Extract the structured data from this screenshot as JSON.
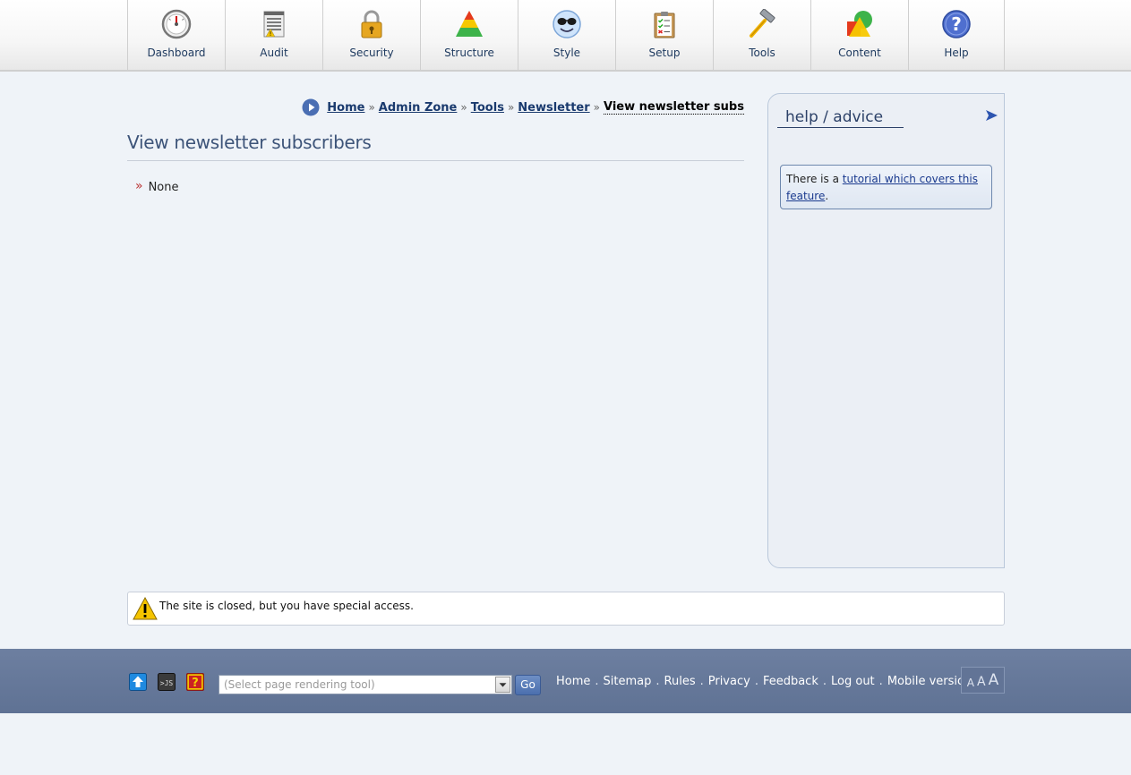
{
  "nav": {
    "items": [
      {
        "label": "Dashboard",
        "icon": "dashboard-gauge-icon"
      },
      {
        "label": "Audit",
        "icon": "audit-document-icon"
      },
      {
        "label": "Security",
        "icon": "padlock-icon"
      },
      {
        "label": "Structure",
        "icon": "pyramid-icon"
      },
      {
        "label": "Style",
        "icon": "sunglasses-smiley-icon"
      },
      {
        "label": "Setup",
        "icon": "clipboard-checklist-icon"
      },
      {
        "label": "Tools",
        "icon": "hammer-icon"
      },
      {
        "label": "Content",
        "icon": "shapes-icon"
      },
      {
        "label": "Help",
        "icon": "question-mark-icon"
      }
    ]
  },
  "breadcrumb": {
    "items": [
      "Home",
      "Admin Zone",
      "Tools",
      "Newsletter"
    ],
    "separator": "»",
    "current": "View newsletter subscri..."
  },
  "main": {
    "title": "View newsletter subscribers",
    "results": [
      "None"
    ]
  },
  "help": {
    "title": "help / advice",
    "text_before": "There is a ",
    "link_text": "tutorial which covers this feature",
    "text_after": "."
  },
  "notice": {
    "text": "The site is closed, but you have special access."
  },
  "footer": {
    "select_placeholder": "(Select page rendering tool)",
    "go_label": "Go",
    "links": [
      "Home",
      "Sitemap",
      "Rules",
      "Privacy",
      "Feedback",
      "Log out",
      "Mobile version"
    ],
    "font_sizes": [
      "A",
      "A",
      "A"
    ]
  },
  "colors": {
    "nav_label": "#1f3b60",
    "link": "#1a3a6e",
    "title": "#3d5479",
    "footer_bg": "#6d7fa0",
    "page_bg": "#eff3f8"
  }
}
